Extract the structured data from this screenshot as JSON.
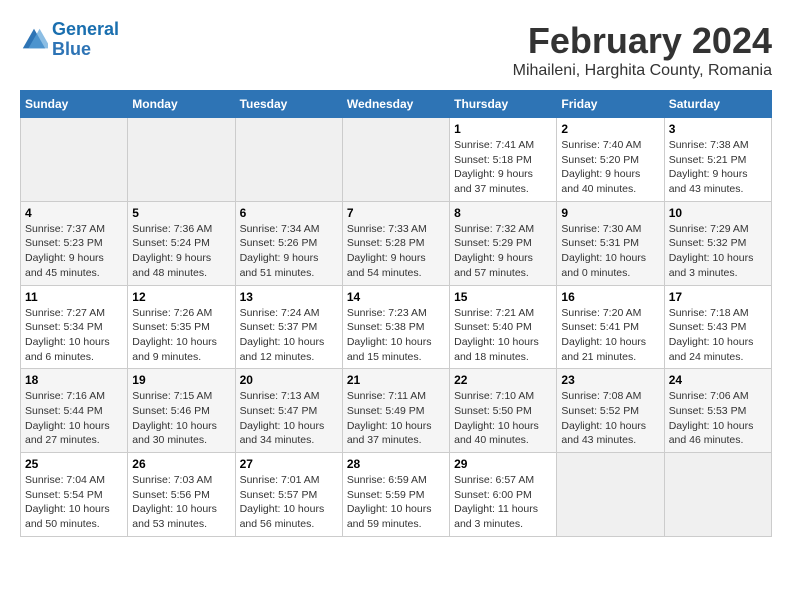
{
  "header": {
    "logo_line1": "General",
    "logo_line2": "Blue",
    "month": "February 2024",
    "location": "Mihaileni, Harghita County, Romania"
  },
  "days_of_week": [
    "Sunday",
    "Monday",
    "Tuesday",
    "Wednesday",
    "Thursday",
    "Friday",
    "Saturday"
  ],
  "weeks": [
    [
      {
        "day": "",
        "info": ""
      },
      {
        "day": "",
        "info": ""
      },
      {
        "day": "",
        "info": ""
      },
      {
        "day": "",
        "info": ""
      },
      {
        "day": "1",
        "info": "Sunrise: 7:41 AM\nSunset: 5:18 PM\nDaylight: 9 hours\nand 37 minutes."
      },
      {
        "day": "2",
        "info": "Sunrise: 7:40 AM\nSunset: 5:20 PM\nDaylight: 9 hours\nand 40 minutes."
      },
      {
        "day": "3",
        "info": "Sunrise: 7:38 AM\nSunset: 5:21 PM\nDaylight: 9 hours\nand 43 minutes."
      }
    ],
    [
      {
        "day": "4",
        "info": "Sunrise: 7:37 AM\nSunset: 5:23 PM\nDaylight: 9 hours\nand 45 minutes."
      },
      {
        "day": "5",
        "info": "Sunrise: 7:36 AM\nSunset: 5:24 PM\nDaylight: 9 hours\nand 48 minutes."
      },
      {
        "day": "6",
        "info": "Sunrise: 7:34 AM\nSunset: 5:26 PM\nDaylight: 9 hours\nand 51 minutes."
      },
      {
        "day": "7",
        "info": "Sunrise: 7:33 AM\nSunset: 5:28 PM\nDaylight: 9 hours\nand 54 minutes."
      },
      {
        "day": "8",
        "info": "Sunrise: 7:32 AM\nSunset: 5:29 PM\nDaylight: 9 hours\nand 57 minutes."
      },
      {
        "day": "9",
        "info": "Sunrise: 7:30 AM\nSunset: 5:31 PM\nDaylight: 10 hours\nand 0 minutes."
      },
      {
        "day": "10",
        "info": "Sunrise: 7:29 AM\nSunset: 5:32 PM\nDaylight: 10 hours\nand 3 minutes."
      }
    ],
    [
      {
        "day": "11",
        "info": "Sunrise: 7:27 AM\nSunset: 5:34 PM\nDaylight: 10 hours\nand 6 minutes."
      },
      {
        "day": "12",
        "info": "Sunrise: 7:26 AM\nSunset: 5:35 PM\nDaylight: 10 hours\nand 9 minutes."
      },
      {
        "day": "13",
        "info": "Sunrise: 7:24 AM\nSunset: 5:37 PM\nDaylight: 10 hours\nand 12 minutes."
      },
      {
        "day": "14",
        "info": "Sunrise: 7:23 AM\nSunset: 5:38 PM\nDaylight: 10 hours\nand 15 minutes."
      },
      {
        "day": "15",
        "info": "Sunrise: 7:21 AM\nSunset: 5:40 PM\nDaylight: 10 hours\nand 18 minutes."
      },
      {
        "day": "16",
        "info": "Sunrise: 7:20 AM\nSunset: 5:41 PM\nDaylight: 10 hours\nand 21 minutes."
      },
      {
        "day": "17",
        "info": "Sunrise: 7:18 AM\nSunset: 5:43 PM\nDaylight: 10 hours\nand 24 minutes."
      }
    ],
    [
      {
        "day": "18",
        "info": "Sunrise: 7:16 AM\nSunset: 5:44 PM\nDaylight: 10 hours\nand 27 minutes."
      },
      {
        "day": "19",
        "info": "Sunrise: 7:15 AM\nSunset: 5:46 PM\nDaylight: 10 hours\nand 30 minutes."
      },
      {
        "day": "20",
        "info": "Sunrise: 7:13 AM\nSunset: 5:47 PM\nDaylight: 10 hours\nand 34 minutes."
      },
      {
        "day": "21",
        "info": "Sunrise: 7:11 AM\nSunset: 5:49 PM\nDaylight: 10 hours\nand 37 minutes."
      },
      {
        "day": "22",
        "info": "Sunrise: 7:10 AM\nSunset: 5:50 PM\nDaylight: 10 hours\nand 40 minutes."
      },
      {
        "day": "23",
        "info": "Sunrise: 7:08 AM\nSunset: 5:52 PM\nDaylight: 10 hours\nand 43 minutes."
      },
      {
        "day": "24",
        "info": "Sunrise: 7:06 AM\nSunset: 5:53 PM\nDaylight: 10 hours\nand 46 minutes."
      }
    ],
    [
      {
        "day": "25",
        "info": "Sunrise: 7:04 AM\nSunset: 5:54 PM\nDaylight: 10 hours\nand 50 minutes."
      },
      {
        "day": "26",
        "info": "Sunrise: 7:03 AM\nSunset: 5:56 PM\nDaylight: 10 hours\nand 53 minutes."
      },
      {
        "day": "27",
        "info": "Sunrise: 7:01 AM\nSunset: 5:57 PM\nDaylight: 10 hours\nand 56 minutes."
      },
      {
        "day": "28",
        "info": "Sunrise: 6:59 AM\nSunset: 5:59 PM\nDaylight: 10 hours\nand 59 minutes."
      },
      {
        "day": "29",
        "info": "Sunrise: 6:57 AM\nSunset: 6:00 PM\nDaylight: 11 hours\nand 3 minutes."
      },
      {
        "day": "",
        "info": ""
      },
      {
        "day": "",
        "info": ""
      }
    ]
  ]
}
